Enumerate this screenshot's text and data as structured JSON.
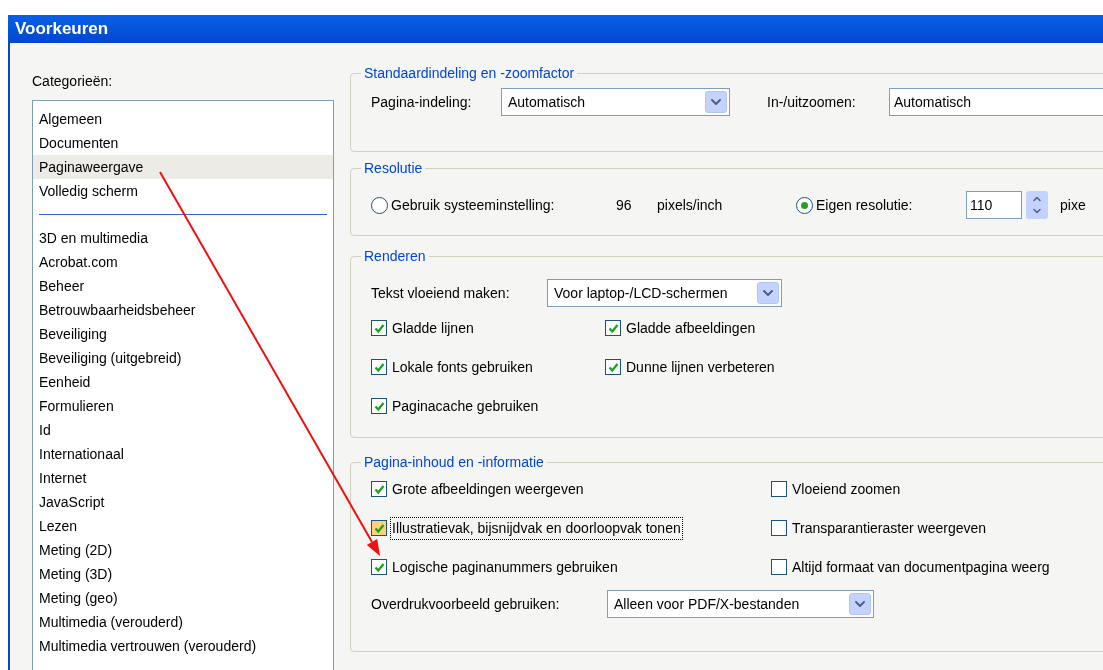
{
  "window": {
    "title": "Voorkeuren"
  },
  "categories": {
    "label": "Categorieën:",
    "top_items": [
      {
        "label": "Algemeen",
        "selected": false
      },
      {
        "label": "Documenten",
        "selected": false
      },
      {
        "label": "Paginaweergave",
        "selected": true
      },
      {
        "label": "Volledig scherm",
        "selected": false
      }
    ],
    "other_items": [
      {
        "label": "3D en multimedia",
        "selected": false
      },
      {
        "label": "Acrobat.com",
        "selected": false
      },
      {
        "label": "Beheer",
        "selected": false
      },
      {
        "label": "Betrouwbaarheidsbeheer",
        "selected": false
      },
      {
        "label": "Beveiliging",
        "selected": false
      },
      {
        "label": "Beveiliging (uitgebreid)",
        "selected": false
      },
      {
        "label": "Eenheid",
        "selected": false
      },
      {
        "label": "Formulieren",
        "selected": false
      },
      {
        "label": "Id",
        "selected": false
      },
      {
        "label": "Internationaal",
        "selected": false
      },
      {
        "label": "Internet",
        "selected": false
      },
      {
        "label": "JavaScript",
        "selected": false
      },
      {
        "label": "Lezen",
        "selected": false
      },
      {
        "label": "Meting (2D)",
        "selected": false
      },
      {
        "label": "Meting (3D)",
        "selected": false
      },
      {
        "label": "Meting (geo)",
        "selected": false
      },
      {
        "label": "Multimedia (verouderd)",
        "selected": false
      },
      {
        "label": "Multimedia vertrouwen (verouderd)",
        "selected": false
      }
    ]
  },
  "layout_zoom": {
    "title": "Standaardindeling en -zoomfactor",
    "page_layout": {
      "label": "Pagina-indeling:",
      "value": "Automatisch"
    },
    "zoom": {
      "label": "In-/uitzoomen:",
      "value": "Automatisch"
    }
  },
  "resolution": {
    "title": "Resolutie",
    "options": [
      {
        "label": "Gebruik systeeminstelling:",
        "selected": false
      },
      {
        "label": "Eigen resolutie:",
        "selected": true
      }
    ],
    "system_value": "96",
    "system_unit": "pixels/inch",
    "custom_value": "110",
    "custom_unit": "pixe"
  },
  "rendering": {
    "title": "Renderen",
    "smooth_text": {
      "label": "Tekst vloeiend maken:",
      "value": "Voor laptop-/LCD-schermen"
    },
    "checkboxes": [
      {
        "label": "Gladde lijnen",
        "checked": true,
        "highlighted": false
      },
      {
        "label": "Gladde afbeeldingen",
        "checked": true,
        "highlighted": false
      },
      {
        "label": "Lokale fonts gebruiken",
        "checked": true,
        "highlighted": false
      },
      {
        "label": "Dunne lijnen verbeteren",
        "checked": true,
        "highlighted": false
      },
      {
        "label": "Paginacache gebruiken",
        "checked": true,
        "highlighted": false
      }
    ]
  },
  "page_content": {
    "title": "Pagina-inhoud en -informatie",
    "checkboxes": [
      {
        "label": "Grote afbeeldingen weergeven",
        "checked": true,
        "highlighted": false
      },
      {
        "label": "Vloeiend zoomen",
        "checked": false,
        "highlighted": false
      },
      {
        "label": "Illustratievak, bijsnijdvak en doorloopvak tonen",
        "checked": true,
        "highlighted": true
      },
      {
        "label": "Transparantieraster weergeven",
        "checked": false,
        "highlighted": false
      },
      {
        "label": "Logische paginanummers gebruiken",
        "checked": true,
        "highlighted": false
      },
      {
        "label": "Altijd formaat van documentpagina weerg",
        "checked": false,
        "highlighted": false
      }
    ],
    "overprint": {
      "label": "Overdrukvoorbeeld gebruiken:",
      "value": "Alleen voor PDF/X-bestanden"
    }
  }
}
